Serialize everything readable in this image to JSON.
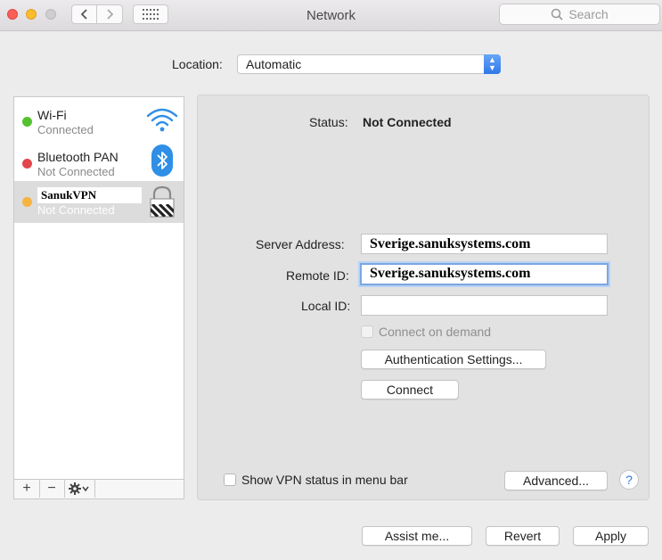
{
  "window": {
    "title": "Network"
  },
  "search": {
    "placeholder": "Search"
  },
  "location": {
    "label": "Location:",
    "value": "Automatic"
  },
  "services": [
    {
      "name": "Wi-Fi",
      "status": "Connected",
      "dot_color": "#54c22e",
      "icon": "wifi-icon"
    },
    {
      "name": "Bluetooth PAN",
      "status": "Not Connected",
      "dot_color": "#e4454a",
      "icon": "bluetooth-icon"
    },
    {
      "name": "SanukVPN",
      "status": "Not Connected",
      "dot_color": "#f6b340",
      "icon": "vpn-lock-icon",
      "selected": true
    }
  ],
  "sidebar_toolbar": {
    "add": "+",
    "remove": "−",
    "action": "gear-icon"
  },
  "detail": {
    "status_label": "Status:",
    "status_value": "Not Connected",
    "server_address_label": "Server Address:",
    "server_address_value": "Sverige.sanuksystems.com",
    "remote_id_label": "Remote ID:",
    "remote_id_value": "Sverige.sanuksystems.com",
    "local_id_label": "Local ID:",
    "local_id_value": "",
    "connect_on_demand_label": "Connect on demand",
    "auth_settings_button": "Authentication Settings...",
    "connect_button": "Connect",
    "show_vpn_status_label": "Show VPN status in menu bar",
    "advanced_button": "Advanced...",
    "help_button": "?"
  },
  "footer": {
    "assist_button": "Assist me...",
    "revert_button": "Revert",
    "apply_button": "Apply"
  },
  "colors": {
    "accent": "#2f78e8",
    "selected_row": "#dcdcdc"
  }
}
